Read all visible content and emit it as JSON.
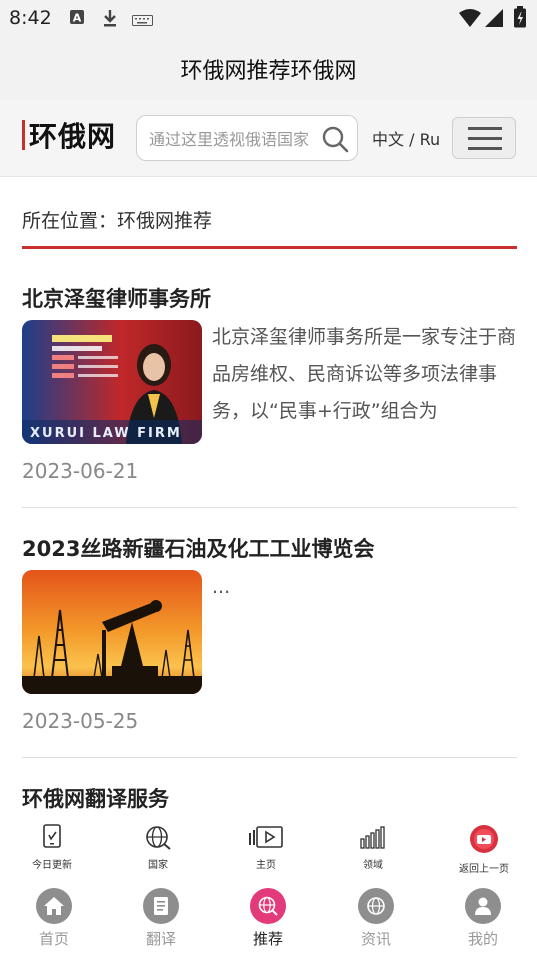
{
  "status_bar": {
    "time": "8:42"
  },
  "title_bar": {
    "title": "环俄网推荐环俄网"
  },
  "header": {
    "logo_text": "环俄网",
    "search_placeholder": "通过这里透视俄语国家",
    "language_label": "中文 / Ru"
  },
  "breadcrumb": {
    "text": "所在位置：环俄网推荐"
  },
  "articles": [
    {
      "title": "北京泽玺律师事务所",
      "excerpt": "北京泽玺律师事务所是一家专注于商品房维权、民商诉讼等多项法律事务，以“民事+行政”组合为",
      "date": "2023-06-21",
      "thumb_text": "XURUI LAW FIRM"
    },
    {
      "title": "2023丝路新疆石油及化工工业博览会",
      "excerpt": "...",
      "date": "2023-05-25"
    },
    {
      "title": "环俄网翻译服务"
    }
  ],
  "quick_links": [
    {
      "label": "今日更新",
      "icon": "tablet-icon"
    },
    {
      "label": "国家",
      "icon": "globe-icon"
    },
    {
      "label": "主页",
      "icon": "video-icon"
    },
    {
      "label": "领域",
      "icon": "signal-bars-icon"
    },
    {
      "label": "返回上一页",
      "icon": "back-icon"
    }
  ],
  "bottom_nav": [
    {
      "label": "首页",
      "icon": "home-icon"
    },
    {
      "label": "翻译",
      "icon": "document-icon"
    },
    {
      "label": "推荐",
      "icon": "globe-search-icon",
      "active": true
    },
    {
      "label": "资讯",
      "icon": "globe-icon"
    },
    {
      "label": "我的",
      "icon": "user-icon"
    }
  ],
  "colors": {
    "accent": "#c8302b",
    "active_nav": "#e23a7a"
  }
}
